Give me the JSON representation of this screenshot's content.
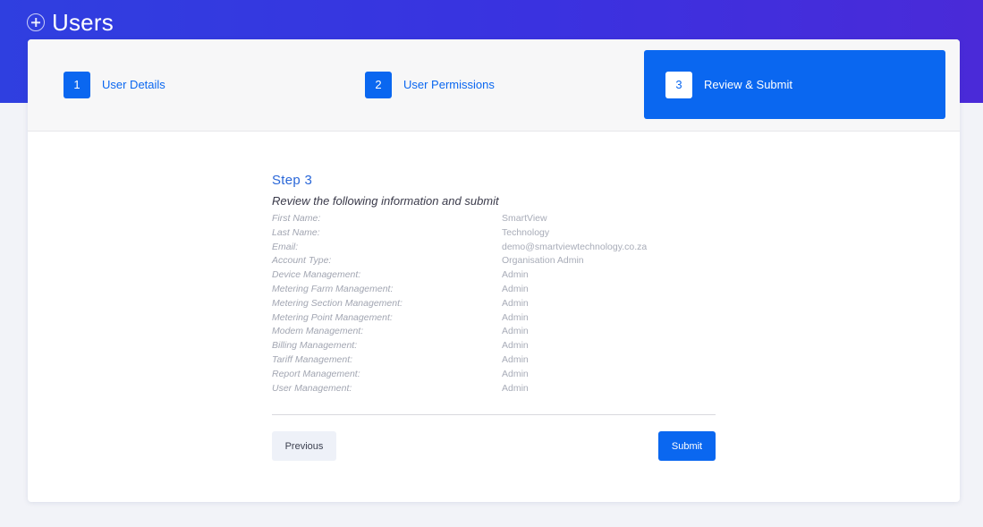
{
  "header": {
    "title": "Users",
    "icon": "plus-circle-icon"
  },
  "stepper": {
    "steps": [
      {
        "number": "1",
        "label": "User Details",
        "active": false
      },
      {
        "number": "2",
        "label": "User Permissions",
        "active": false
      },
      {
        "number": "3",
        "label": "Review & Submit",
        "active": true
      }
    ]
  },
  "review": {
    "heading": "Step 3",
    "subheading": "Review the following information and submit",
    "rows": [
      {
        "key": "First Name:",
        "value": "SmartView"
      },
      {
        "key": "Last Name:",
        "value": "Technology"
      },
      {
        "key": "Email:",
        "value": "demo@smartviewtechnology.co.za"
      },
      {
        "key": "Account Type:",
        "value": "Organisation Admin"
      },
      {
        "key": "Device Management:",
        "value": "Admin"
      },
      {
        "key": "Metering Farm Management:",
        "value": "Admin"
      },
      {
        "key": "Metering Section Management:",
        "value": "Admin"
      },
      {
        "key": "Metering Point Management:",
        "value": "Admin"
      },
      {
        "key": "Modem Management:",
        "value": "Admin"
      },
      {
        "key": "Billing Management:",
        "value": "Admin"
      },
      {
        "key": "Tariff Management:",
        "value": "Admin"
      },
      {
        "key": "Report Management:",
        "value": "Admin"
      },
      {
        "key": "User Management:",
        "value": "Admin"
      }
    ]
  },
  "actions": {
    "previous_label": "Previous",
    "submit_label": "Submit"
  },
  "colors": {
    "accent": "#0a67f0",
    "header_gradient_start": "#2f3fe0",
    "header_gradient_end": "#4a2ad8"
  }
}
